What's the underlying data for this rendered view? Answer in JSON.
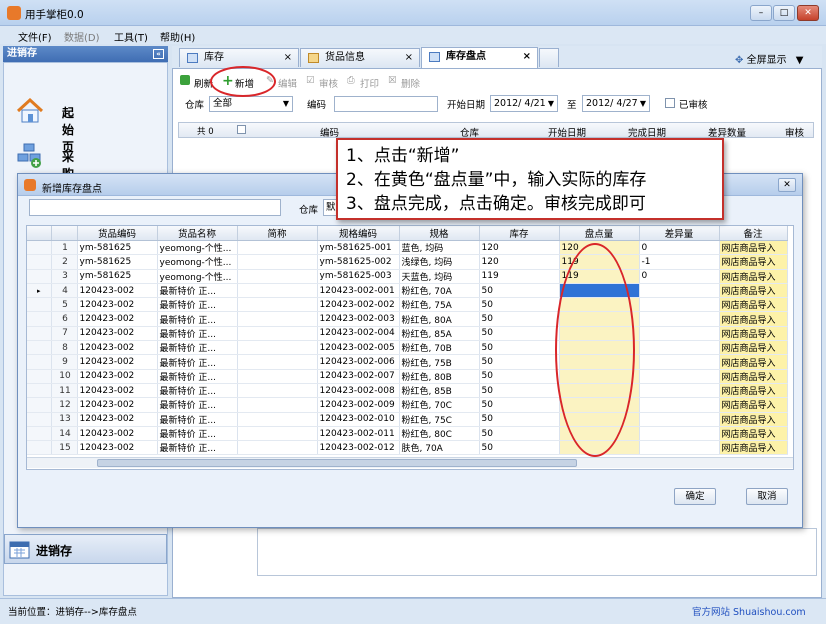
{
  "app": {
    "title": "用手掌柜0.0",
    "icon": "app-logo-icon"
  },
  "window_controls": {
    "minimize": "–",
    "maximize": "□",
    "close": "✕"
  },
  "menu": [
    "文件(F)",
    "数据(D)",
    "工具(T)",
    "帮助(H)"
  ],
  "sidebar": {
    "title": "进销存",
    "pin": "«",
    "items": [
      {
        "label": "起始页",
        "icon": "home-icon"
      },
      {
        "label": "采购",
        "icon": "purchase-icon"
      }
    ],
    "footer_label": "进销存"
  },
  "tabs": [
    {
      "label": "库存"
    },
    {
      "label": "货品信息"
    },
    {
      "label": "库存盘点",
      "active": true
    }
  ],
  "tab_close": "×",
  "fullscreen": {
    "label": "全屏显示",
    "arrow": "▼"
  },
  "toolbar": {
    "refresh": "刷新",
    "add": "新增",
    "edit": "编辑",
    "audit": "审核",
    "print": "打印",
    "delete": "删除"
  },
  "filter": {
    "warehouse_label": "仓库",
    "warehouse_value": "全部",
    "code_label": "编码",
    "code_value": "",
    "start_label": "开始日期",
    "start_value": "2012/ 4/21",
    "to_label": "至",
    "end_value": "2012/ 4/27",
    "audited_label": "已审核"
  },
  "list_header": {
    "count": "共 0",
    "columns": [
      "编码",
      "仓库",
      "开始日期",
      "完成日期",
      "差异数量",
      "审核"
    ]
  },
  "callout": {
    "lines": [
      "1、点击“新增”",
      "2、在黄色“盘点量”中，输入实际的库存",
      "3、盘点完成，点击确定。审核完成即可"
    ]
  },
  "dialog": {
    "title": "新增库存盘点",
    "close": "✕",
    "search_value": "",
    "warehouse_label": "仓库",
    "warehouse_value": "默",
    "columns": [
      "货品编码",
      "货品名称",
      "简称",
      "规格编码",
      "规格",
      "库存",
      "盘点量",
      "差异量",
      "备注"
    ],
    "rows": [
      [
        "1",
        "ym-581625",
        "yeomong-个性...",
        "",
        "ym-581625-001",
        "蓝色, 均码",
        "120",
        "120",
        "0",
        "网店商品导入"
      ],
      [
        "2",
        "ym-581625",
        "yeomong-个性...",
        "",
        "ym-581625-002",
        "浅绿色, 均码",
        "120",
        "119",
        "-1",
        "网店商品导入"
      ],
      [
        "3",
        "ym-581625",
        "yeomong-个性...",
        "",
        "ym-581625-003",
        "天蓝色, 均码",
        "119",
        "119",
        "0",
        "网店商品导入"
      ],
      [
        "4",
        "120423-002",
        "最新特价 正...",
        "",
        "120423-002-001",
        "粉红色, 70A",
        "50",
        "",
        "",
        "网店商品导入"
      ],
      [
        "5",
        "120423-002",
        "最新特价 正...",
        "",
        "120423-002-002",
        "粉红色, 75A",
        "50",
        "",
        "",
        "网店商品导入"
      ],
      [
        "6",
        "120423-002",
        "最新特价 正...",
        "",
        "120423-002-003",
        "粉红色, 80A",
        "50",
        "",
        "",
        "网店商品导入"
      ],
      [
        "7",
        "120423-002",
        "最新特价 正...",
        "",
        "120423-002-004",
        "粉红色, 85A",
        "50",
        "",
        "",
        "网店商品导入"
      ],
      [
        "8",
        "120423-002",
        "最新特价 正...",
        "",
        "120423-002-005",
        "粉红色, 70B",
        "50",
        "",
        "",
        "网店商品导入"
      ],
      [
        "9",
        "120423-002",
        "最新特价 正...",
        "",
        "120423-002-006",
        "粉红色, 75B",
        "50",
        "",
        "",
        "网店商品导入"
      ],
      [
        "10",
        "120423-002",
        "最新特价 正...",
        "",
        "120423-002-007",
        "粉红色, 80B",
        "50",
        "",
        "",
        "网店商品导入"
      ],
      [
        "11",
        "120423-002",
        "最新特价 正...",
        "",
        "120423-002-008",
        "粉红色, 85B",
        "50",
        "",
        "",
        "网店商品导入"
      ],
      [
        "12",
        "120423-002",
        "最新特价 正...",
        "",
        "120423-002-009",
        "粉红色, 70C",
        "50",
        "",
        "",
        "网店商品导入"
      ],
      [
        "13",
        "120423-002",
        "最新特价 正...",
        "",
        "120423-002-010",
        "粉红色, 75C",
        "50",
        "",
        "",
        "网店商品导入"
      ],
      [
        "14",
        "120423-002",
        "最新特价 正...",
        "",
        "120423-002-011",
        "粉红色, 80C",
        "50",
        "",
        "",
        "网店商品导入"
      ],
      [
        "15",
        "120423-002",
        "最新特价 正...",
        "",
        "120423-002-012",
        "肤色, 70A",
        "50",
        "",
        "",
        "网店商品导入"
      ]
    ],
    "current_row": "▸",
    "ok": "确定",
    "cancel": "取消"
  },
  "status": {
    "location": "当前位置：进销存-->库存盘点",
    "site": "官方网站 Shuaishou.com"
  },
  "colors": {
    "accent_red": "#c4302b",
    "input_yellow": "#fbf3c2",
    "selection": "#2f73d6"
  }
}
